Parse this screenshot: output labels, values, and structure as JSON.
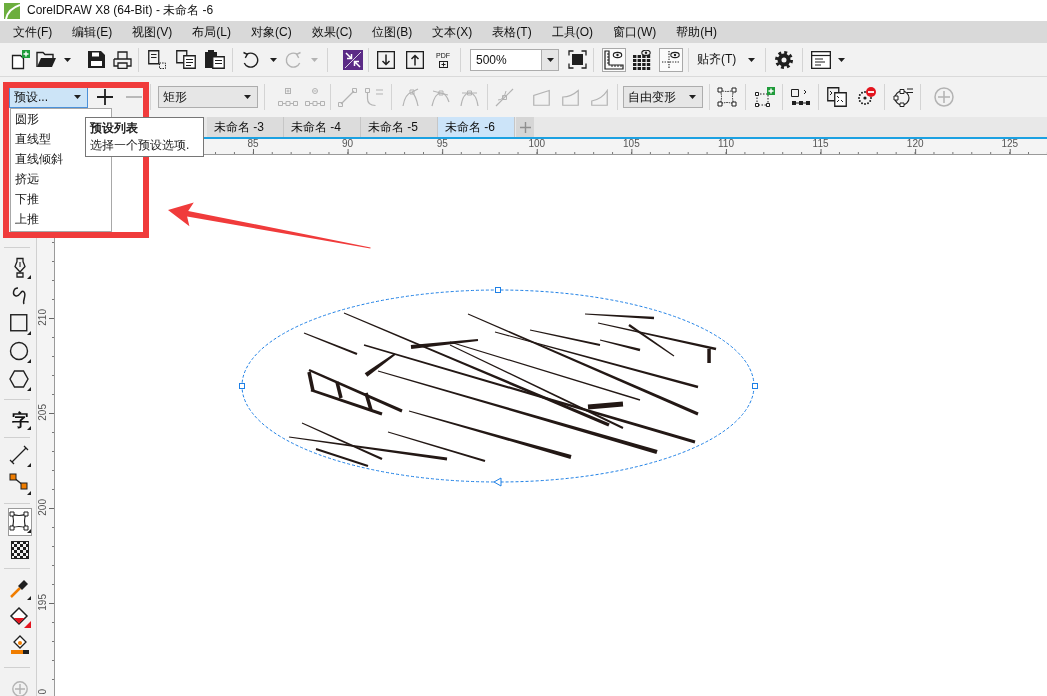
{
  "window": {
    "title": "CorelDRAW X8 (64-Bit) - 未命名 -6"
  },
  "menu_bar": [
    "文件(F)",
    "编辑(E)",
    "视图(V)",
    "布局(L)",
    "对象(C)",
    "效果(C)",
    "位图(B)",
    "文本(X)",
    "表格(T)",
    "工具(O)",
    "窗口(W)",
    "帮助(H)"
  ],
  "standard_toolbar": {
    "redo_button": {
      "disabled": true
    },
    "pdf_button": {
      "label": "PDF"
    },
    "zoom_field": {
      "value": "500%"
    },
    "rulers_toggle": {
      "on": true
    },
    "grid_toggle": {
      "on": false
    },
    "guidelines_toggle": {
      "on": true
    },
    "snap_button": {
      "label": "贴齐(T)"
    }
  },
  "property_bar": {
    "preset_combo": {
      "value": "预设...",
      "expanded": true,
      "options": [
        {
          "label": "圆形",
          "selected": false
        },
        {
          "label": "直线型",
          "selected": false
        },
        {
          "label": "直线倾斜",
          "selected": false
        },
        {
          "label": "挤远",
          "selected": false
        },
        {
          "label": "下推",
          "selected": false
        },
        {
          "label": "上推",
          "selected": false
        }
      ]
    },
    "add_preset_button": {
      "disabled": false
    },
    "remove_preset_button": {
      "disabled": true
    },
    "shape_combo": {
      "value": "矩形"
    },
    "node_buttons": [
      {
        "disabled": true
      },
      {
        "disabled": true
      },
      {
        "disabled": true
      },
      {
        "disabled": true
      },
      {
        "disabled": true
      },
      {
        "disabled": true
      },
      {
        "disabled": true
      },
      {
        "disabled": true
      },
      {
        "disabled": true
      },
      {
        "disabled": true
      },
      {
        "disabled": true
      }
    ],
    "mode_combo": {
      "value": "自由变形"
    },
    "envelope_buttons": [
      {
        "disabled": false
      },
      {
        "disabled": false
      },
      {
        "disabled": false
      },
      {
        "disabled": false
      },
      {
        "disabled": false
      },
      {
        "disabled": false
      },
      {
        "disabled": true
      }
    ]
  },
  "tooltip": {
    "title": "预设列表",
    "text": "选择一个预设选项."
  },
  "document_tabs": [
    {
      "label": "未命名 -3",
      "selected": false
    },
    {
      "label": "未命名 -4",
      "selected": false
    },
    {
      "label": "未命名 -5",
      "selected": false
    },
    {
      "label": "未命名 -6",
      "selected": true
    }
  ],
  "horizontal_ruler": {
    "labels": [
      "85",
      "90",
      "95",
      "100",
      "105",
      "110",
      "115",
      "120",
      "125"
    ]
  },
  "vertical_ruler": {
    "labels": [
      "210",
      "205",
      "200",
      "195",
      "0"
    ]
  },
  "toolbox": {
    "tools": [
      {
        "selected": false
      },
      {
        "selected": false
      },
      {
        "selected": false
      },
      {
        "selected": false
      },
      {
        "selected": false
      },
      {
        "selected": false,
        "glyph": "字"
      },
      {
        "selected": false
      },
      {
        "selected": false
      },
      {
        "selected": true
      },
      {
        "selected": false
      },
      {
        "selected": false
      },
      {
        "selected": false
      },
      {
        "selected": false
      }
    ]
  },
  "annotations": [
    {
      "kind": "frame"
    },
    {
      "kind": "arrow"
    }
  ]
}
